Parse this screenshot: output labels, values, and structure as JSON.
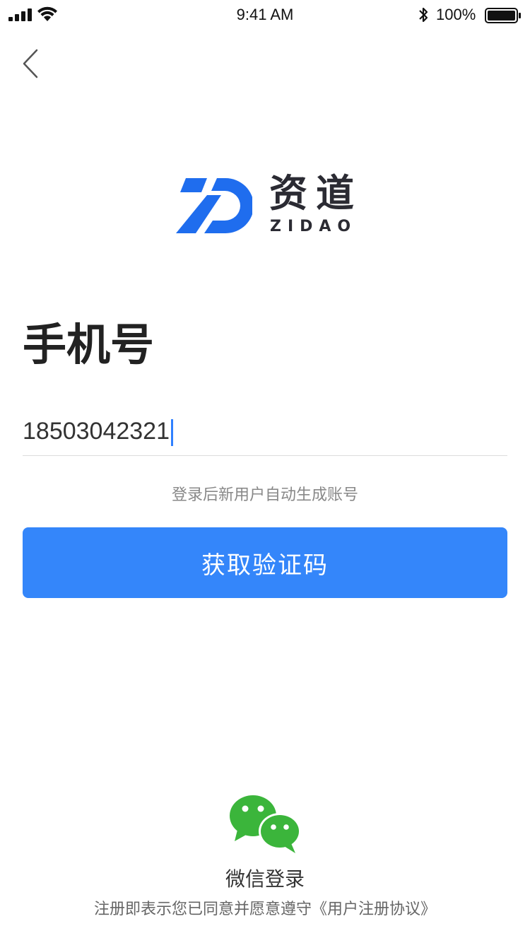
{
  "status_bar": {
    "time": "9:41 AM",
    "battery_percent": "100%",
    "battery_level": 1.0
  },
  "nav": {
    "back_icon": "chevron-left-icon"
  },
  "logo": {
    "mark_icon": "zidao-logo-mark",
    "name_cn": "资道",
    "name_en": "ZIDAO",
    "color": "#1f6dee"
  },
  "form": {
    "title": "手机号",
    "phone_value": "18503042321",
    "hint": "登录后新用户自动生成账号",
    "submit_label": "获取验证码",
    "accent_color": "#3486fa"
  },
  "footer": {
    "wechat_icon": "wechat-icon",
    "wechat_label": "微信登录",
    "agreement_prefix": "注册即表示您已同意并愿意遵守",
    "agreement_link": "《用户注册协议》",
    "wechat_color": "#3bb53b"
  }
}
